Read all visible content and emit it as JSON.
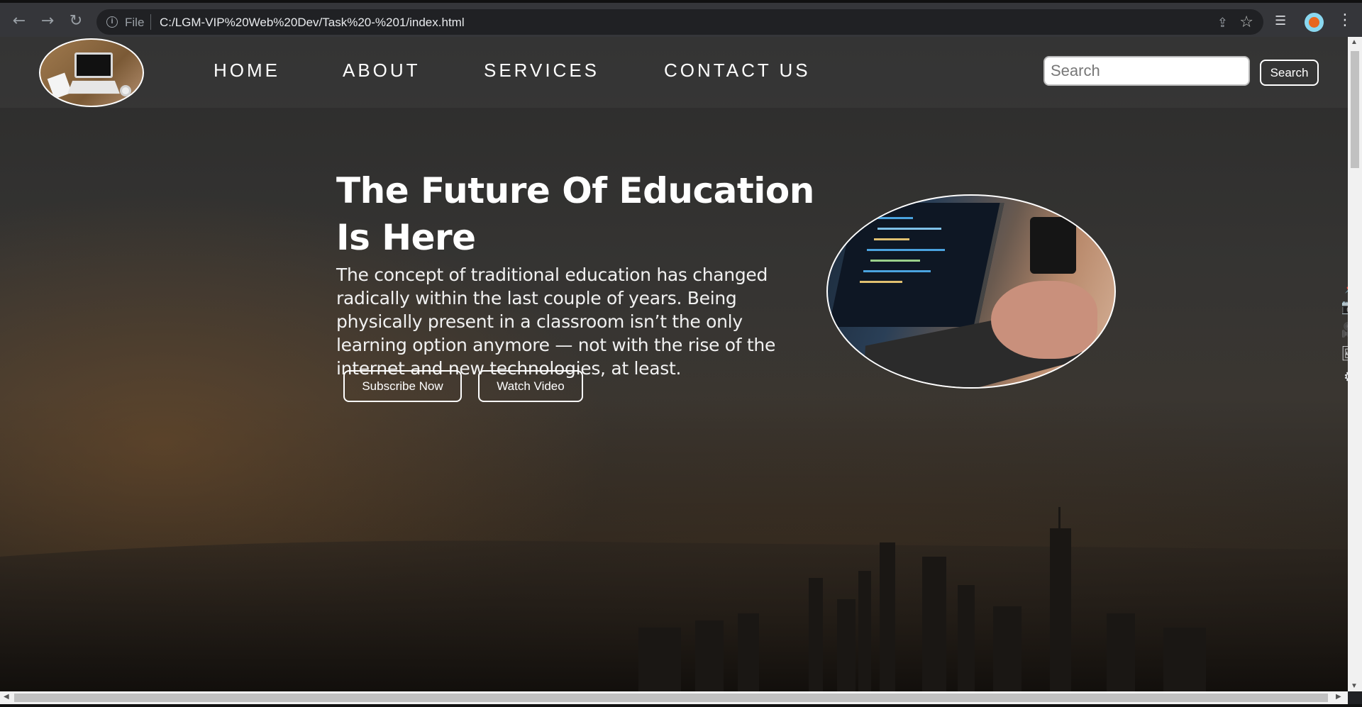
{
  "browser": {
    "scheme": "File",
    "url": "C:/LGM-VIP%20Web%20Dev/Task%20-%201/index.html",
    "icons": [
      "back-icon",
      "forward-icon",
      "reload-icon",
      "info-icon",
      "share-icon",
      "star-icon",
      "tab-search-icon",
      "profile-avatar",
      "menu-icon"
    ]
  },
  "nav": {
    "home": "HOME",
    "about": "ABOUT",
    "services": "SERVICES",
    "contact": "CONTACT US"
  },
  "search": {
    "placeholder": "Search",
    "button": "Search"
  },
  "hero": {
    "title": "The Future Of Education Is Here",
    "text": "The concept of traditional education has changed radically within the last couple of years. Being physically present in a classroom isn’t the only learning option anymore — not with the rise of the internet and new technologies, at least.",
    "subscribe_label": "Subscribe Now",
    "watch_label": "Watch Video"
  },
  "side_tools": [
    "pin-icon",
    "camera-icon",
    "video-icon",
    "gallery-icon",
    "settings-icon"
  ]
}
